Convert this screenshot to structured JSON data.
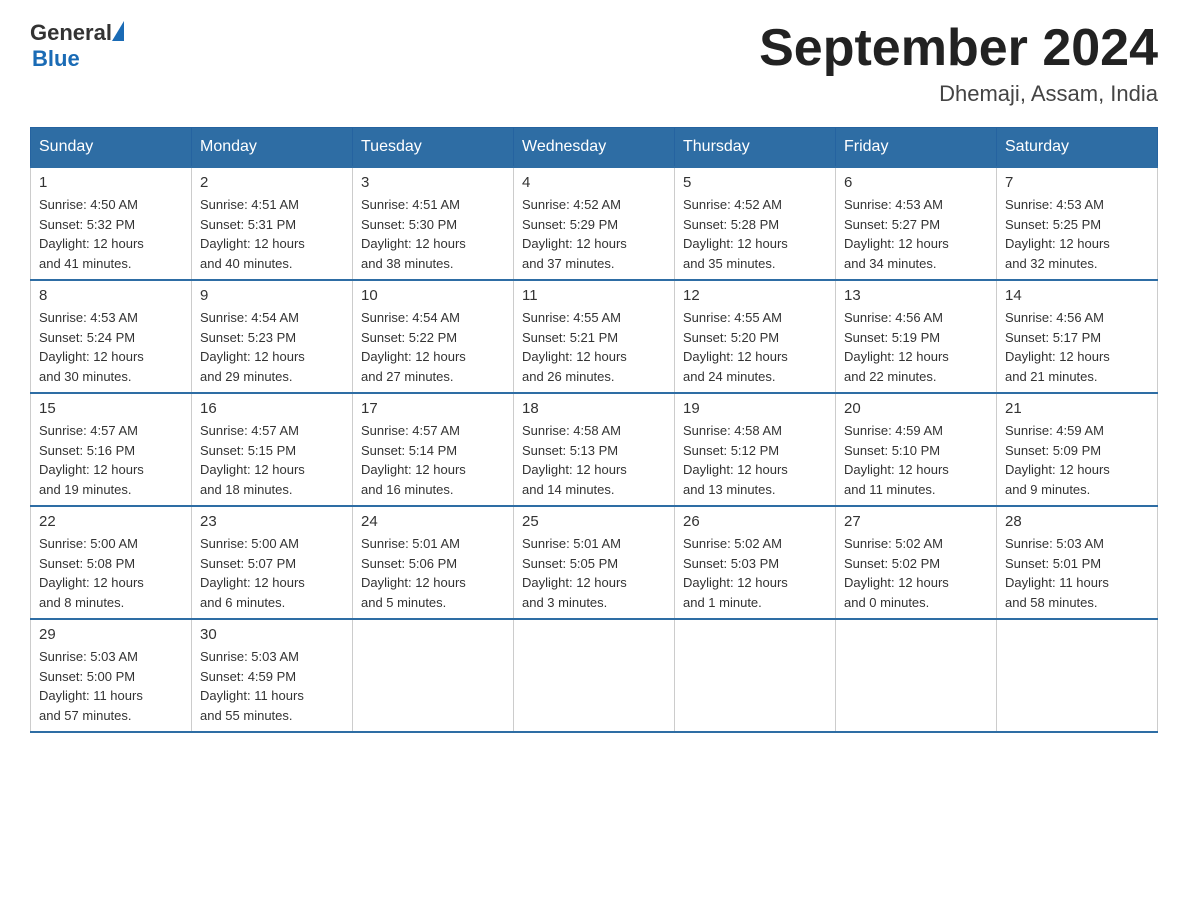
{
  "header": {
    "logo": {
      "general": "General",
      "blue": "Blue"
    },
    "title": "September 2024",
    "location": "Dhemaji, Assam, India"
  },
  "weekdays": [
    "Sunday",
    "Monday",
    "Tuesday",
    "Wednesday",
    "Thursday",
    "Friday",
    "Saturday"
  ],
  "weeks": [
    [
      {
        "day": "1",
        "sunrise": "4:50 AM",
        "sunset": "5:32 PM",
        "daylight": "12 hours and 41 minutes."
      },
      {
        "day": "2",
        "sunrise": "4:51 AM",
        "sunset": "5:31 PM",
        "daylight": "12 hours and 40 minutes."
      },
      {
        "day": "3",
        "sunrise": "4:51 AM",
        "sunset": "5:30 PM",
        "daylight": "12 hours and 38 minutes."
      },
      {
        "day": "4",
        "sunrise": "4:52 AM",
        "sunset": "5:29 PM",
        "daylight": "12 hours and 37 minutes."
      },
      {
        "day": "5",
        "sunrise": "4:52 AM",
        "sunset": "5:28 PM",
        "daylight": "12 hours and 35 minutes."
      },
      {
        "day": "6",
        "sunrise": "4:53 AM",
        "sunset": "5:27 PM",
        "daylight": "12 hours and 34 minutes."
      },
      {
        "day": "7",
        "sunrise": "4:53 AM",
        "sunset": "5:25 PM",
        "daylight": "12 hours and 32 minutes."
      }
    ],
    [
      {
        "day": "8",
        "sunrise": "4:53 AM",
        "sunset": "5:24 PM",
        "daylight": "12 hours and 30 minutes."
      },
      {
        "day": "9",
        "sunrise": "4:54 AM",
        "sunset": "5:23 PM",
        "daylight": "12 hours and 29 minutes."
      },
      {
        "day": "10",
        "sunrise": "4:54 AM",
        "sunset": "5:22 PM",
        "daylight": "12 hours and 27 minutes."
      },
      {
        "day": "11",
        "sunrise": "4:55 AM",
        "sunset": "5:21 PM",
        "daylight": "12 hours and 26 minutes."
      },
      {
        "day": "12",
        "sunrise": "4:55 AM",
        "sunset": "5:20 PM",
        "daylight": "12 hours and 24 minutes."
      },
      {
        "day": "13",
        "sunrise": "4:56 AM",
        "sunset": "5:19 PM",
        "daylight": "12 hours and 22 minutes."
      },
      {
        "day": "14",
        "sunrise": "4:56 AM",
        "sunset": "5:17 PM",
        "daylight": "12 hours and 21 minutes."
      }
    ],
    [
      {
        "day": "15",
        "sunrise": "4:57 AM",
        "sunset": "5:16 PM",
        "daylight": "12 hours and 19 minutes."
      },
      {
        "day": "16",
        "sunrise": "4:57 AM",
        "sunset": "5:15 PM",
        "daylight": "12 hours and 18 minutes."
      },
      {
        "day": "17",
        "sunrise": "4:57 AM",
        "sunset": "5:14 PM",
        "daylight": "12 hours and 16 minutes."
      },
      {
        "day": "18",
        "sunrise": "4:58 AM",
        "sunset": "5:13 PM",
        "daylight": "12 hours and 14 minutes."
      },
      {
        "day": "19",
        "sunrise": "4:58 AM",
        "sunset": "5:12 PM",
        "daylight": "12 hours and 13 minutes."
      },
      {
        "day": "20",
        "sunrise": "4:59 AM",
        "sunset": "5:10 PM",
        "daylight": "12 hours and 11 minutes."
      },
      {
        "day": "21",
        "sunrise": "4:59 AM",
        "sunset": "5:09 PM",
        "daylight": "12 hours and 9 minutes."
      }
    ],
    [
      {
        "day": "22",
        "sunrise": "5:00 AM",
        "sunset": "5:08 PM",
        "daylight": "12 hours and 8 minutes."
      },
      {
        "day": "23",
        "sunrise": "5:00 AM",
        "sunset": "5:07 PM",
        "daylight": "12 hours and 6 minutes."
      },
      {
        "day": "24",
        "sunrise": "5:01 AM",
        "sunset": "5:06 PM",
        "daylight": "12 hours and 5 minutes."
      },
      {
        "day": "25",
        "sunrise": "5:01 AM",
        "sunset": "5:05 PM",
        "daylight": "12 hours and 3 minutes."
      },
      {
        "day": "26",
        "sunrise": "5:02 AM",
        "sunset": "5:03 PM",
        "daylight": "12 hours and 1 minute."
      },
      {
        "day": "27",
        "sunrise": "5:02 AM",
        "sunset": "5:02 PM",
        "daylight": "12 hours and 0 minutes."
      },
      {
        "day": "28",
        "sunrise": "5:03 AM",
        "sunset": "5:01 PM",
        "daylight": "11 hours and 58 minutes."
      }
    ],
    [
      {
        "day": "29",
        "sunrise": "5:03 AM",
        "sunset": "5:00 PM",
        "daylight": "11 hours and 57 minutes."
      },
      {
        "day": "30",
        "sunrise": "5:03 AM",
        "sunset": "4:59 PM",
        "daylight": "11 hours and 55 minutes."
      },
      null,
      null,
      null,
      null,
      null
    ]
  ],
  "labels": {
    "sunrise": "Sunrise:",
    "sunset": "Sunset:",
    "daylight": "Daylight:"
  }
}
